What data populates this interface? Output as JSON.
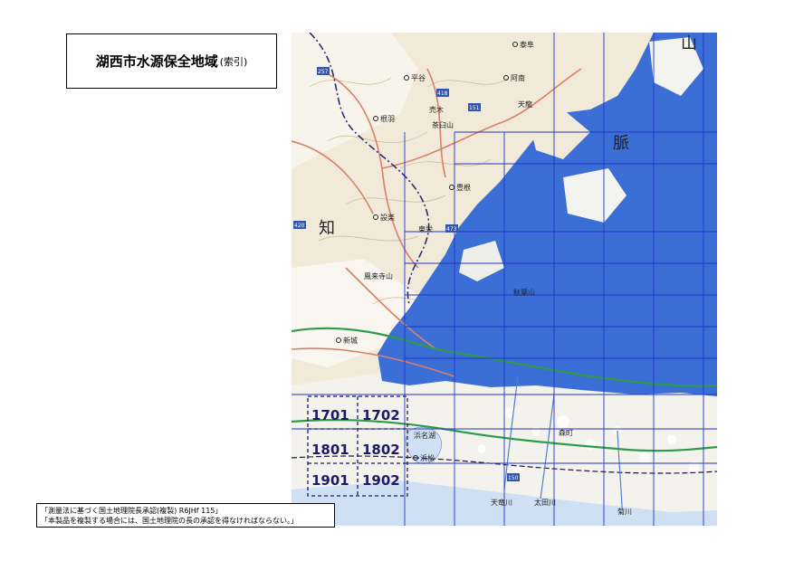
{
  "title": {
    "main": "湖西市水源保全地域",
    "sub": "(索引)"
  },
  "tiles": [
    {
      "id": "1701",
      "label": "1701"
    },
    {
      "id": "1702",
      "label": "1702"
    },
    {
      "id": "1801",
      "label": "1801"
    },
    {
      "id": "1802",
      "label": "1802"
    },
    {
      "id": "1901",
      "label": "1901"
    },
    {
      "id": "1902",
      "label": "1902"
    }
  ],
  "map_labels": {
    "place_1": "平谷",
    "place_2": "根羽",
    "place_3": "売木",
    "place_4": "天龍",
    "place_5": "豊根",
    "place_6": "設楽",
    "place_7": "東栄",
    "place_8": "新城",
    "place_9": "茶臼山",
    "place_10": "鳳来寺山",
    "place_11": "秋葉山",
    "place_12": "浜名湖",
    "place_13": "浜松",
    "place_14": "森町",
    "place_15": "泰阜",
    "place_16": "阿南",
    "char_1": "知",
    "char_2": "脈",
    "char_3": "山",
    "river_1": "天竜川",
    "river_2": "太田川",
    "river_3": "菊川",
    "route_1": "418",
    "route_2": "151",
    "route_3": "257",
    "route_4": "420",
    "route_5": "473",
    "route_6": "150"
  },
  "notice": {
    "line1": "「測量法に基づく国土地理院長承認(複製) R6JHf 115」",
    "line2": "「本製品を複製する場合には、国土地理院の長の承認を得なければならない。」"
  },
  "colors": {
    "watershed": "#3b6fd6",
    "grid": "#2233cc",
    "tile_border": "#1a1a66",
    "terrain": "#efe6d2",
    "sea": "#cfe0f5"
  }
}
